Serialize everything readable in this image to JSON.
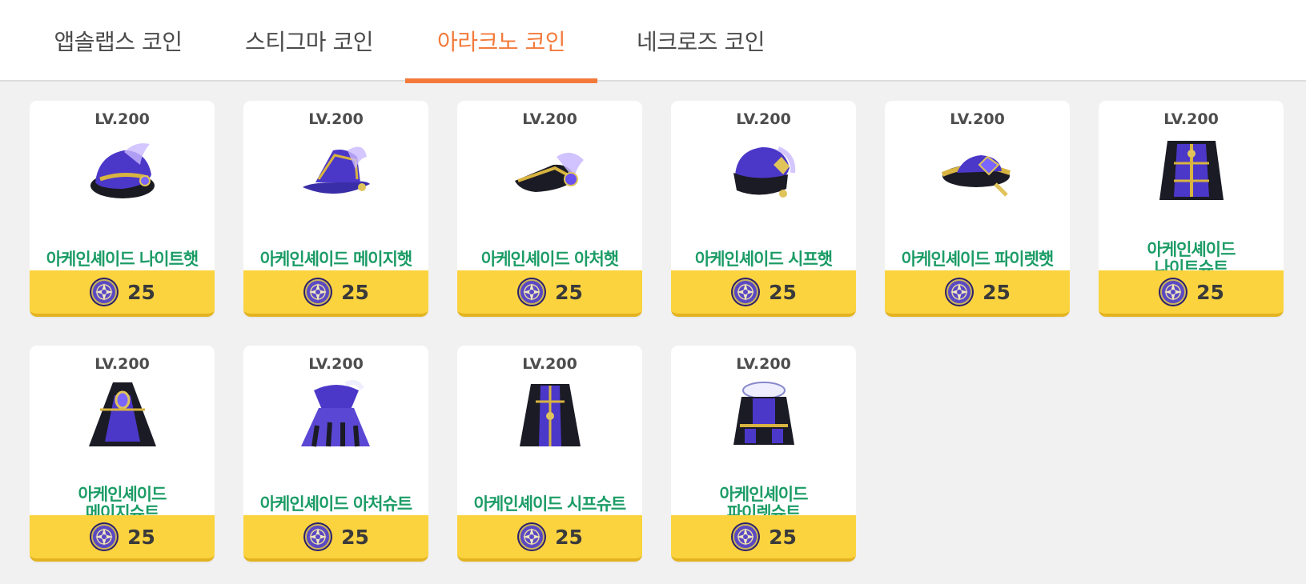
{
  "tabs": [
    {
      "label": "앱솔랩스 코인"
    },
    {
      "label": "스티그마 코인"
    },
    {
      "label": "아라크노 코인"
    },
    {
      "label": "네크로즈 코인"
    }
  ],
  "active_tab": "아라크노 코인",
  "colors": {
    "accent": "#f37a3b",
    "item_name": "#1c9c66",
    "price_bar": "#fbd33f",
    "coin": "#4a3aa8"
  },
  "currency_icon": "arcane-coin-icon",
  "items": [
    {
      "level": "LV.200",
      "name": "아케인셰이드 나이트햇",
      "price": "25",
      "icon": "knight-hat-icon"
    },
    {
      "level": "LV.200",
      "name": "아케인셰이드 메이지햇",
      "price": "25",
      "icon": "mage-hat-icon"
    },
    {
      "level": "LV.200",
      "name": "아케인셰이드 아처햇",
      "price": "25",
      "icon": "archer-hat-icon"
    },
    {
      "level": "LV.200",
      "name": "아케인셰이드 시프햇",
      "price": "25",
      "icon": "thief-hat-icon"
    },
    {
      "level": "LV.200",
      "name": "아케인셰이드 파이렛햇",
      "price": "25",
      "icon": "pirate-hat-icon"
    },
    {
      "level": "LV.200",
      "name": "아케인셰이드\n나이트슈트",
      "price": "25",
      "icon": "knight-suit-icon"
    },
    {
      "level": "LV.200",
      "name": "아케인셰이드\n메이지슈트",
      "price": "25",
      "icon": "mage-suit-icon"
    },
    {
      "level": "LV.200",
      "name": "아케인셰이드 아처슈트",
      "price": "25",
      "icon": "archer-suit-icon"
    },
    {
      "level": "LV.200",
      "name": "아케인셰이드 시프슈트",
      "price": "25",
      "icon": "thief-suit-icon"
    },
    {
      "level": "LV.200",
      "name": "아케인셰이드\n파이렛슈트",
      "price": "25",
      "icon": "pirate-suit-icon"
    }
  ]
}
